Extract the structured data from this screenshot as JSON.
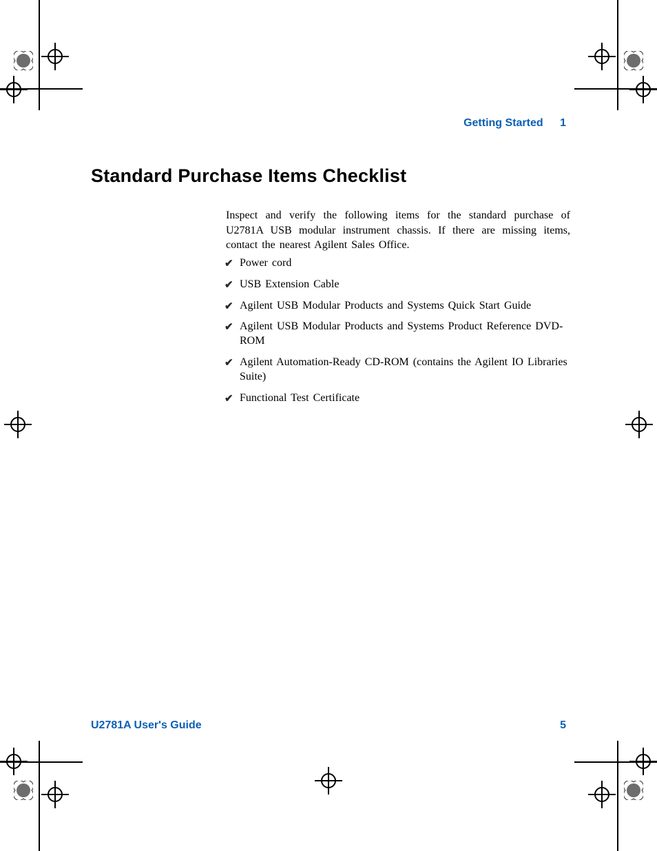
{
  "header": {
    "section": "Getting Started",
    "chapter_number": "1"
  },
  "title": "Standard Purchase Items Checklist",
  "intro": "Inspect and verify the following items for the standard purchase of U2781A USB modular instrument chassis. If there are missing items, contact the nearest Agilent Sales Office.",
  "items": [
    "Power cord",
    "USB Extension Cable",
    "Agilent USB Modular Products and Systems Quick Start Guide",
    "Agilent USB Modular Products and Systems Product Reference DVD-ROM",
    "Agilent Automation-Ready CD-ROM (contains the Agilent IO Libraries Suite)",
    "Functional Test Certificate"
  ],
  "footer": {
    "doc_title": "U2781A User's Guide",
    "page_number": "5"
  },
  "check_glyph": "✔"
}
